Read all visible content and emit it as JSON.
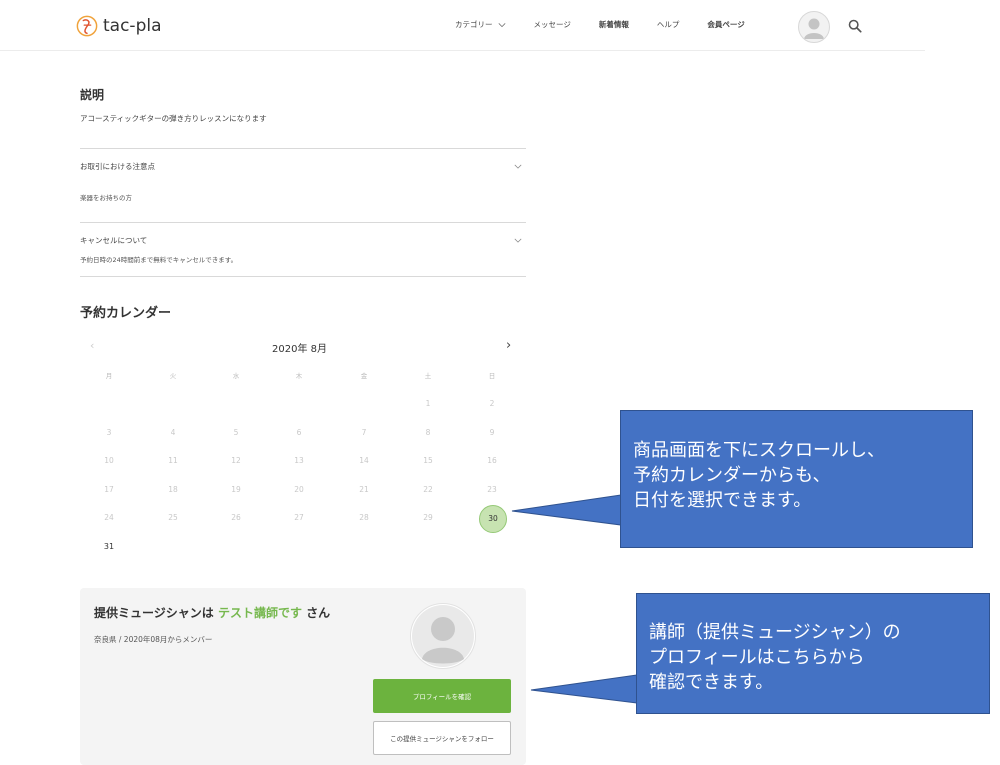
{
  "header": {
    "logo_text": "tac-pla",
    "nav": [
      {
        "label": "カテゴリー",
        "has_dropdown": true
      },
      {
        "label": "メッセージ",
        "has_dropdown": false
      },
      {
        "label": "新着情報",
        "has_dropdown": false
      },
      {
        "label": "ヘルプ",
        "has_dropdown": false
      },
      {
        "label": "会員ページ",
        "has_dropdown": false
      }
    ]
  },
  "description": {
    "title": "説明",
    "text": "アコースティックギターの弾き方りレッスンになります"
  },
  "accordions": [
    {
      "title": "お取引における注意点",
      "body": "楽器をお持ちの方"
    },
    {
      "title": "キャンセルについて",
      "body": "予約日時の24時間前まで無料でキャンセルできます。"
    }
  ],
  "calendar": {
    "title": "予約カレンダー",
    "month_label": "2020年 8月",
    "prev": "‹",
    "next": "›",
    "weekdays": [
      "月",
      "火",
      "水",
      "木",
      "金",
      "土",
      "日"
    ],
    "weeks": [
      [
        "",
        "",
        "",
        "",
        "",
        "1",
        "2"
      ],
      [
        "3",
        "4",
        "5",
        "6",
        "7",
        "8",
        "9"
      ],
      [
        "10",
        "11",
        "12",
        "13",
        "14",
        "15",
        "16"
      ],
      [
        "17",
        "18",
        "19",
        "20",
        "21",
        "22",
        "23"
      ],
      [
        "24",
        "25",
        "26",
        "27",
        "28",
        "29",
        "30"
      ],
      [
        "31",
        "",
        "",
        "",
        "",
        "",
        ""
      ]
    ],
    "selected_day": "30",
    "active_days": [
      "31"
    ]
  },
  "musician": {
    "title_prefix": "提供ミュージシャンは",
    "name": "テスト講師です",
    "title_suffix": "さん",
    "subtitle": "奈良県 / 2020年08月からメンバー",
    "profile_button": "プロフィールを確認",
    "follow_button": "この提供ミュージシャンをフォロー"
  },
  "callouts": [
    {
      "lines": [
        "商品画面を下にスクロールし、",
        "予約カレンダーからも、",
        "日付を選択できます。"
      ]
    },
    {
      "lines": [
        "講師（提供ミュージシャン）の",
        "プロフィールはこちらから",
        "確認できます。"
      ]
    }
  ],
  "colors": {
    "brand_green": "#6cb33e",
    "highlight_green": "#76b84e",
    "selected_day": "#c7e3b1",
    "callout_blue": "#4472c4"
  }
}
